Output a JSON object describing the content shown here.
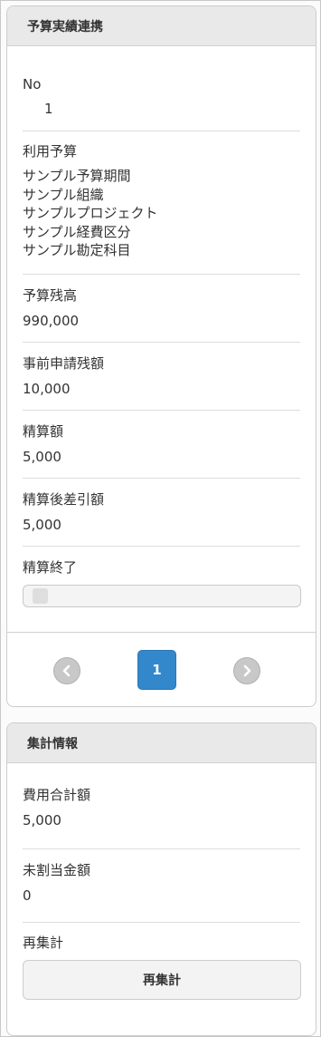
{
  "budget_panel": {
    "title": "予算実績連携",
    "no": {
      "label": "No",
      "value": "1"
    },
    "budget_used": {
      "label": "利用予算",
      "lines": [
        "サンプル予算期間",
        "サンプル組織",
        "サンプルプロジェクト",
        "サンプル経費区分",
        "サンプル勘定科目"
      ]
    },
    "budget_balance": {
      "label": "予算残高",
      "value": "990,000"
    },
    "pre_request_balance": {
      "label": "事前申請残額",
      "value": "10,000"
    },
    "settlement_amount": {
      "label": "精算額",
      "value": "5,000"
    },
    "post_settlement_diff": {
      "label": "精算後差引額",
      "value": "5,000"
    },
    "settlement_complete": {
      "label": "精算終了",
      "checked": false
    },
    "pager": {
      "current_page": "1",
      "prev_icon": "chevron-left-icon",
      "next_icon": "chevron-right-icon"
    }
  },
  "summary_panel": {
    "title": "集計情報",
    "total_cost": {
      "label": "費用合計額",
      "value": "5,000"
    },
    "unallocated": {
      "label": "未割当金額",
      "value": "0"
    },
    "recalc": {
      "label": "再集計",
      "button_label": "再集計"
    }
  },
  "colors": {
    "header_bg": "#e9e9e9",
    "active_page": "#3388cc",
    "pager_button": "#c8c8c8"
  }
}
